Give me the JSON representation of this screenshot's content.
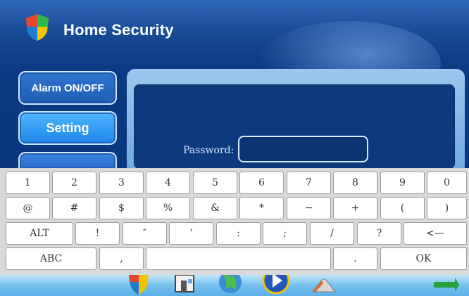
{
  "app": {
    "title": "Home Security"
  },
  "sidebar": {
    "items": [
      {
        "label": "Alarm ON/OFF"
      },
      {
        "label": "Setting"
      },
      {
        "label": ""
      }
    ]
  },
  "login": {
    "password_label": "Password:",
    "password_value": ""
  },
  "keyboard": {
    "row1": [
      "1",
      "2",
      "3",
      "4",
      "5",
      "6",
      "7",
      "8",
      "9",
      "0"
    ],
    "row2": [
      "@",
      "#",
      "$",
      "%",
      "&",
      "*",
      "−",
      "+",
      "(",
      ")"
    ],
    "row3": [
      "ALT",
      "!",
      "″",
      "’",
      ":",
      ";",
      "/",
      "?",
      "<—"
    ],
    "row4": [
      "ABC",
      ",",
      "",
      ".",
      "OK"
    ]
  },
  "dock": {
    "icons": [
      "shield-icon",
      "house-icon",
      "globe-icon",
      "media-player-icon",
      "pencil-icon",
      "arrow-icon"
    ]
  },
  "colors": {
    "accent": "#1d86e8",
    "keyboard_bg": "#d9d9d9",
    "panel": "#0d3a7d"
  }
}
